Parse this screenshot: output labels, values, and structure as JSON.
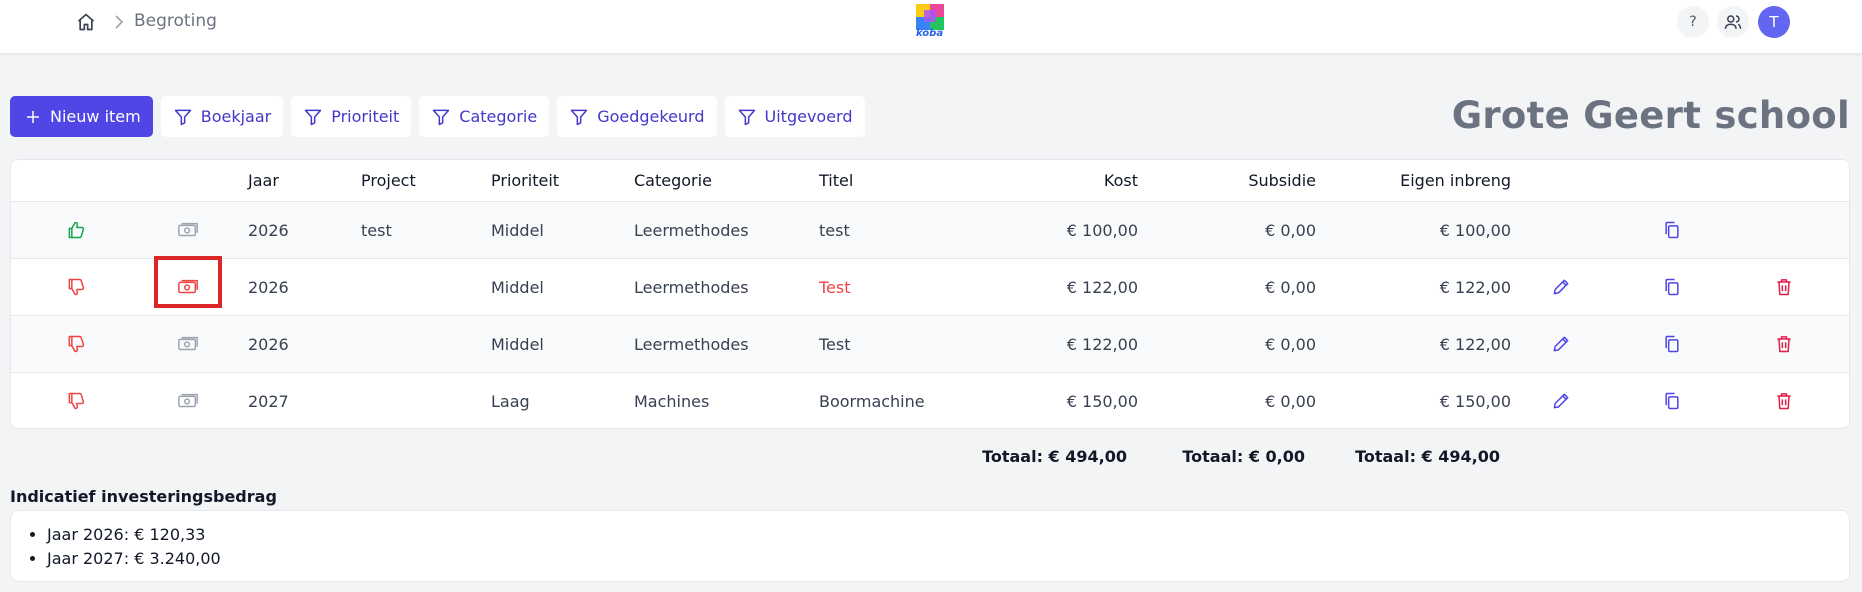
{
  "breadcrumb": {
    "current": "Begroting"
  },
  "header": {
    "help_label": "?",
    "avatar_initial": "T",
    "logo_text": "koba"
  },
  "toolbar": {
    "new_item_label": "Nieuw item",
    "filters": [
      "Boekjaar",
      "Prioriteit",
      "Categorie",
      "Goedgekeurd",
      "Uitgevoerd"
    ]
  },
  "school_name": "Grote Geert school",
  "table": {
    "headers": {
      "jaar": "Jaar",
      "project": "Project",
      "prioriteit": "Prioriteit",
      "categorie": "Categorie",
      "titel": "Titel",
      "kost": "Kost",
      "subsidie": "Subsidie",
      "eigen": "Eigen inbreng"
    },
    "rows": [
      {
        "approved": true,
        "jaar": "2026",
        "project": "test",
        "prioriteit": "Middel",
        "categorie": "Leermethodes",
        "titel": "test",
        "kost": "€ 100,00",
        "subsidie": "€ 0,00",
        "eigen": "€ 100,00",
        "editable": false
      },
      {
        "approved": false,
        "jaar": "2026",
        "project": "",
        "prioriteit": "Middel",
        "categorie": "Leermethodes",
        "titel": "Test",
        "kost": "€ 122,00",
        "subsidie": "€ 0,00",
        "eigen": "€ 122,00",
        "editable": true,
        "title_color": "#ef4444"
      },
      {
        "approved": false,
        "jaar": "2026",
        "project": "",
        "prioriteit": "Middel",
        "categorie": "Leermethodes",
        "titel": "Test",
        "kost": "€ 122,00",
        "subsidie": "€ 0,00",
        "eigen": "€ 122,00",
        "editable": true
      },
      {
        "approved": false,
        "jaar": "2027",
        "project": "",
        "prioriteit": "Laag",
        "categorie": "Machines",
        "titel": "Boormachine",
        "kost": "€ 150,00",
        "subsidie": "€ 0,00",
        "eigen": "€ 150,00",
        "editable": true
      }
    ]
  },
  "totals": {
    "kost": "Totaal: € 494,00",
    "subsidie": "Totaal: € 0,00",
    "eigen": "Totaal: € 494,00"
  },
  "investment": {
    "title": "Indicatief investeringsbedrag",
    "items": [
      "Jaar 2026: € 120,33",
      "Jaar 2027: € 3.240,00"
    ]
  },
  "colors": {
    "primary": "#4f46e5",
    "approved": "#16a34a",
    "rejected": "#ef4444",
    "highlight": "#dc2626",
    "action": "#4f46e5",
    "delete": "#e11d48"
  }
}
